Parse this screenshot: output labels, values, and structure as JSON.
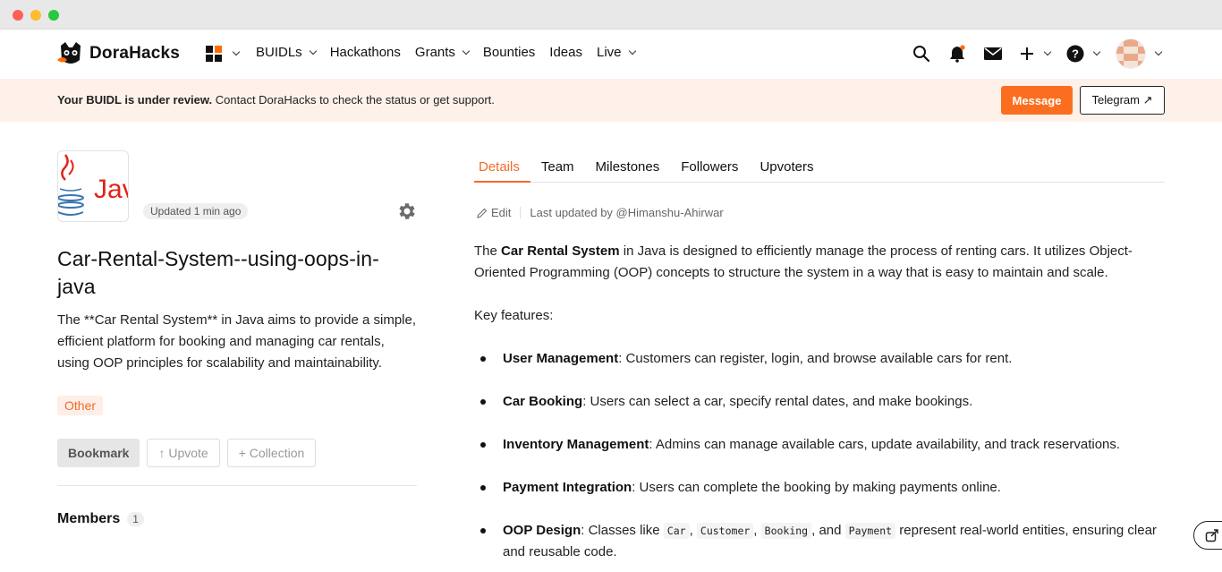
{
  "nav": {
    "logo_text": "DoraHacks",
    "items": [
      {
        "label": "BUIDLs",
        "dropdown": true
      },
      {
        "label": "Hackathons",
        "dropdown": false
      },
      {
        "label": "Grants",
        "dropdown": true
      },
      {
        "label": "Bounties",
        "dropdown": false
      },
      {
        "label": "Ideas",
        "dropdown": false
      },
      {
        "label": "Live",
        "dropdown": true
      }
    ],
    "accent_color": "#ff6b00",
    "icons": [
      "search-icon",
      "bell-icon",
      "mail-icon",
      "plus-icon",
      "help-icon",
      "avatar"
    ]
  },
  "banner": {
    "bold_text": "Your BUIDL is under review.",
    "text": " Contact DoraHacks to check the status or get support.",
    "message_label": "Message",
    "telegram_label": "Telegram ↗",
    "background": "#fdf1ea"
  },
  "project": {
    "logo_text": "Jav",
    "updated": "Updated 1 min ago",
    "title": "Car-Rental-System--using-oops-in-java",
    "description": "The **Car Rental System** in Java aims to provide a simple, efficient platform for booking and managing car rentals, using OOP principles for scalability and maintainability.",
    "tag": "Other",
    "bookmark_label": "Bookmark",
    "upvote_label": "↑ Upvote",
    "collection_label": "+ Collection",
    "members_label": "Members",
    "members_count": "1"
  },
  "tabs": [
    {
      "label": "Details",
      "active": true
    },
    {
      "label": "Team",
      "active": false
    },
    {
      "label": "Milestones",
      "active": false
    },
    {
      "label": "Followers",
      "active": false
    },
    {
      "label": "Upvoters",
      "active": false
    }
  ],
  "details": {
    "edit_label": "Edit",
    "last_updated": "Last updated by @Himanshu-Ahirwar",
    "intro_pre": "The ",
    "intro_bold": "Car Rental System",
    "intro_post": " in Java is designed to efficiently manage the process of renting cars. It utilizes Object-Oriented Programming (OOP) concepts to structure the system in a way that is easy to maintain and scale.",
    "key_features": "Key features:",
    "features": [
      {
        "title": "User Management",
        "text": ": Customers can register, login, and browse available cars for rent."
      },
      {
        "title": "Car Booking",
        "text": ": Users can select a car, specify rental dates, and make bookings."
      },
      {
        "title": "Inventory Management",
        "text": ": Admins can manage available cars, update availability, and track reservations."
      },
      {
        "title": "Payment Integration",
        "text": ": Users can complete the booking by making payments online."
      }
    ],
    "oop": {
      "title": "OOP Design",
      "pre": ": Classes like ",
      "codes": [
        "Car",
        "Customer",
        "Booking",
        "Payment"
      ],
      "sep1": ", ",
      "sep2": ", ",
      "sep3": ", and ",
      "post": " represent real-world entities, ensuring clear and reusable code."
    }
  }
}
